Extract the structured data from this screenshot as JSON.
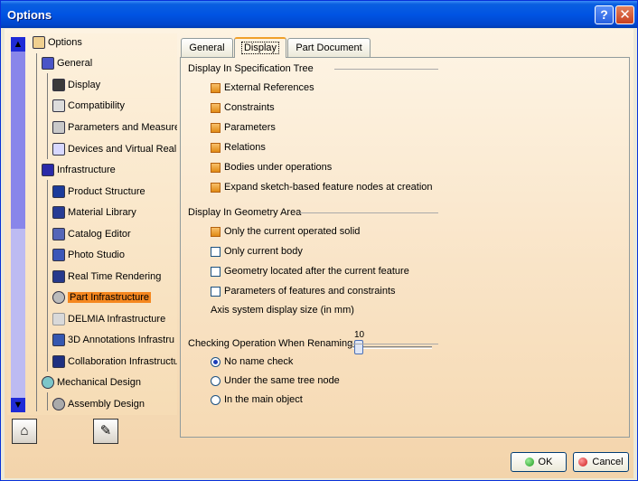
{
  "window": {
    "title": "Options",
    "help_label": "?",
    "close_label": "✕"
  },
  "tree": {
    "items": [
      {
        "label": "Options",
        "icon": "options-icon"
      },
      {
        "label": "General",
        "icon": "general-icon"
      },
      {
        "label": "Display",
        "icon": "display-icon"
      },
      {
        "label": "Compatibility",
        "icon": "compatibility-icon"
      },
      {
        "label": "Parameters and Measure",
        "icon": "parameters-icon"
      },
      {
        "label": "Devices and Virtual Realit",
        "icon": "devices-icon"
      },
      {
        "label": "Infrastructure",
        "icon": "infrastructure-icon"
      },
      {
        "label": "Product Structure",
        "icon": "product-structure-icon"
      },
      {
        "label": "Material Library",
        "icon": "material-library-icon"
      },
      {
        "label": "Catalog Editor",
        "icon": "catalog-editor-icon"
      },
      {
        "label": "Photo Studio",
        "icon": "photo-studio-icon"
      },
      {
        "label": "Real Time Rendering",
        "icon": "real-time-rendering-icon"
      },
      {
        "label": "Part Infrastructure",
        "icon": "part-infrastructure-icon",
        "selected": true
      },
      {
        "label": "DELMIA Infrastructure",
        "icon": "delmia-icon"
      },
      {
        "label": "3D Annotations Infrastru",
        "icon": "annotations-icon"
      },
      {
        "label": "Collaboration Infrastructu",
        "icon": "collaboration-icon"
      },
      {
        "label": "Mechanical Design",
        "icon": "mechanical-design-icon"
      },
      {
        "label": "Assembly Design",
        "icon": "assembly-design-icon"
      }
    ],
    "scroll_up": "▲",
    "scroll_down": "▼"
  },
  "tabs": [
    {
      "label": "General"
    },
    {
      "label": "Display",
      "active": true
    },
    {
      "label": "Part Document"
    }
  ],
  "sections": {
    "spec_tree": {
      "title": "Display In Specification Tree",
      "options": [
        {
          "label": "External References",
          "checked": true
        },
        {
          "label": "Constraints",
          "checked": true
        },
        {
          "label": "Parameters",
          "checked": true
        },
        {
          "label": "Relations",
          "checked": true
        },
        {
          "label": "Bodies under operations",
          "checked": true
        },
        {
          "label": "Expand sketch-based feature nodes at creation",
          "checked": true
        }
      ]
    },
    "geometry": {
      "title": "Display In Geometry Area",
      "options": [
        {
          "label": "Only the current operated solid",
          "checked": true
        },
        {
          "label": "Only current body",
          "checked": false
        },
        {
          "label": "Geometry located after the current feature",
          "checked": false
        },
        {
          "label": "Parameters of features and constraints",
          "checked": false
        }
      ],
      "axis_label": "Axis system display size (in mm)",
      "axis_value": "10"
    },
    "renaming": {
      "title": "Checking Operation When Renaming",
      "options": [
        {
          "label": "No name check",
          "selected": true
        },
        {
          "label": "Under the same tree node",
          "selected": false
        },
        {
          "label": "In the main object",
          "selected": false
        }
      ]
    }
  },
  "buttons": {
    "ok": "OK",
    "cancel": "Cancel"
  },
  "colors": {
    "titlebar": "#0054e3",
    "selection": "#f5871f",
    "checked": "#e08a14"
  }
}
